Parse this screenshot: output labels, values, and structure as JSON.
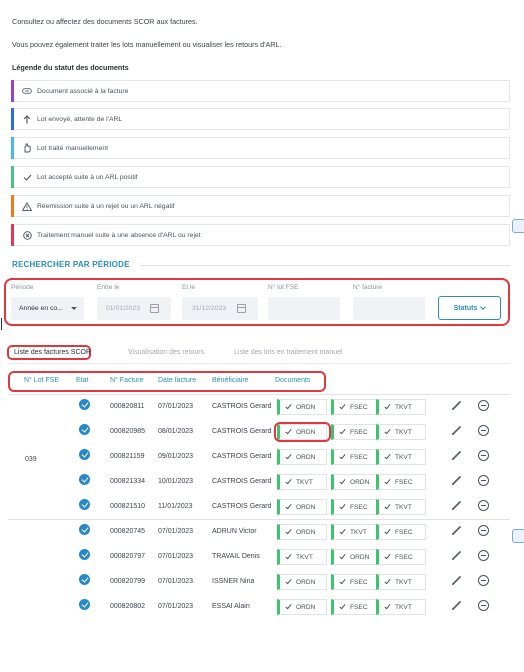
{
  "intro": {
    "line1": "Consultez ou affectez des documents SCOR aux factures.",
    "line2": "Vous pouvez également traiter les lots manuellement ou visualiser les retours d'ARL."
  },
  "legend": {
    "title": "Légende du statut des documents",
    "items": [
      {
        "label": "Document associé à la facture",
        "color": "#8e44d9",
        "icon": "link-icon"
      },
      {
        "label": "Lot envoyé, attente de l'ARL",
        "color": "#2b6fd6",
        "icon": "arrow-up-icon"
      },
      {
        "label": "Lot traité manuellement",
        "color": "#49b8e8",
        "icon": "hand-icon"
      },
      {
        "label": "Lot accepté suite à un ARL positif",
        "color": "#49c47c",
        "icon": "check-icon"
      },
      {
        "label": "Réemission suite à un rejet ou un ARL négatif",
        "color": "#f07a1a",
        "icon": "warning-icon"
      },
      {
        "label": "Traitement manuel suite à une absence d'ARL ou rejet",
        "color": "#e0385a",
        "icon": "cross-circle-icon"
      }
    ]
  },
  "search": {
    "title": "RECHERCHER PAR PÉRIODE",
    "periode_label": "Période",
    "periode_value": "Année en co...",
    "entre_label": "Entre le",
    "entre_value": "01/01/2023",
    "et_label": "Et le",
    "et_value": "31/12/2023",
    "lot_label": "N° lot FSE",
    "lot_value": "",
    "facture_label": "N° facture",
    "facture_value": "",
    "statuts_button": "Statuts"
  },
  "tabs": [
    {
      "label": "Liste des factures SCOR",
      "active": true
    },
    {
      "label": "Visualisation des retours",
      "active": false
    },
    {
      "label": "Liste des lots en traitement manuel",
      "active": false
    }
  ],
  "table": {
    "headers": [
      "N° Lot FSE",
      "Etat",
      "N° Facture",
      "Date facture",
      "Bénéficiaire",
      "Documents"
    ],
    "lot_label": "039",
    "rows": [
      {
        "num": "000820811",
        "date": "07/01/2023",
        "benef": "CASTROIS Gerard",
        "docs": [
          "ORDN",
          "FSEC",
          "TKVT"
        ]
      },
      {
        "num": "000820985",
        "date": "08/01/2023",
        "benef": "CASTROIS Gerard",
        "docs": [
          "ORDN",
          "FSEC",
          "TKVT"
        ]
      },
      {
        "num": "000821159",
        "date": "09/01/2023",
        "benef": "CASTROIS Gerard",
        "docs": [
          "ORDN",
          "FSEC",
          "TKVT"
        ]
      },
      {
        "num": "000821334",
        "date": "10/01/2023",
        "benef": "CASTROIS Gerard",
        "docs": [
          "TKVT",
          "ORDN",
          "FSEC"
        ]
      },
      {
        "num": "000821510",
        "date": "11/01/2023",
        "benef": "CASTROIS Gerard",
        "docs": [
          "ORDN",
          "FSEC",
          "TKVT"
        ]
      },
      {
        "num": "000820745",
        "date": "07/01/2023",
        "benef": "ADRUN Victor",
        "docs": [
          "ORDN",
          "TKVT",
          "FSEC"
        ]
      },
      {
        "num": "000820797",
        "date": "07/01/2023",
        "benef": "TRAVAIL Denis",
        "docs": [
          "TKVT",
          "ORDN",
          "FSEC"
        ]
      },
      {
        "num": "000820799",
        "date": "07/01/2023",
        "benef": "ISSNER Nina",
        "docs": [
          "ORDN",
          "FSEC",
          "TKVT"
        ]
      },
      {
        "num": "000820802",
        "date": "07/01/2023",
        "benef": "ESSAI Alain",
        "docs": [
          "ORDN",
          "FSEC",
          "TKVT"
        ]
      }
    ]
  },
  "colors": {
    "accent": "#2a8ec0",
    "highlight": "#e0383e",
    "doc_ok": "#3cc46f",
    "status_ok": "#2588c9"
  }
}
